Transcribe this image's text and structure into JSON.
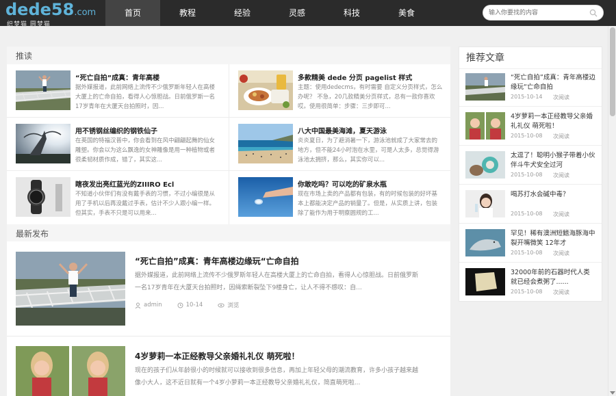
{
  "header": {
    "logo_text": "dede58",
    "logo_domain": ".com",
    "logo_slogan": "织梦猫 圆梦猫",
    "nav": [
      "首页",
      "教程",
      "经验",
      "灵感",
      "科技",
      "美食"
    ],
    "search_placeholder": "输入你要找的内容"
  },
  "recommend": {
    "heading": "推读",
    "items": [
      {
        "title": "“死亡自拍”成真：青年高楼",
        "desc": "据外媒报道，此前网络上流传不少俄罗斯年轻人在高楼大厦上的亡命自拍，看得人心惊胆战。日前俄罗斯一名17岁青年在大厦天台拍照时，因..."
      },
      {
        "title": "多款精美 dede 分页 pagelist 样式",
        "desc": "主题：使用dedecms，有时需要 自定义分页样式，怎么办呢？ 不急，20几款精美分页样式，总有一款你喜欢哎。使用很简单：步骤：三步即可..."
      },
      {
        "title": "用不锈钢丝编织的钢铁仙子",
        "desc": "在英国的特福汉普中，你会看到在风中翩翩起舞的仙女雕塑。你会以为这么飘逸的女神雕像是用一种植物或者很柔韧材质作成，错了，其实这..."
      },
      {
        "title": "八大中国最美海滩，夏天游泳",
        "desc": "炎炎夏日，为了避消暑一下，游泳池就成了大家常去的地方，但不能24小时泡在水里，可是人太多，总觉得游泳池太拥挤，那么，其实你可以..."
      },
      {
        "title": "瞎夜发出亮红蓝光的ZIIIRO Ecl",
        "desc": "不知道小伙伴们有没有戴手表的习惯，不过小编很是从用了手机以后再没戴过手表，估计不少人跟小编一样。但其实，手表不只是可以用来..."
      },
      {
        "title": "你敢吃吗？可以吃的矿泉水瓶",
        "desc": "现在市场上卖的产品都有包装，有的时候包装的好坏基本上都能决定产品的销量了。但是，从实质上讲，包装除了能作为用于明察圆规的工..."
      }
    ]
  },
  "latest": {
    "heading": "最新发布",
    "items": [
      {
        "title": "“死亡自拍”成真：青年高楼边缘玩“亡命自拍",
        "desc": "据外媒报道，此前网络上流传不少俄罗斯年轻人在高楼大厦上的亡命自拍，看得人心惊胆战。日前俄罗斯一名17岁青年在大厦天台拍照时，因绳索断裂坠下9楼身亡，让人不得不感叹：自...",
        "author": "admin",
        "date": "10-14",
        "views": "浏览"
      },
      {
        "title": "4岁萝莉一本正经教导父亲婚礼礼仪 萌死啦！",
        "desc": "现在的孩子们从年龄很小的时候就可以接收到很多信息，再加上年轻父母的潮流教育，许多小孩子越来越像小大人，这不近日就有一个4岁小萝莉一本正经教导父亲婚礼礼仪，简直萌死啦..."
      }
    ]
  },
  "sidebar": {
    "heading": "推荐文章",
    "items": [
      {
        "title": "“死亡自拍”成真：青年高楼边缘玩“亡命自拍",
        "date": "2015-10-14",
        "views": "次阅读"
      },
      {
        "title": "4岁萝莉一本正经教导父亲婚礼礼仪 萌死啦！",
        "date": "2015-10-08",
        "views": "次阅读"
      },
      {
        "title": "太逗了！聪明小猴子带着小伙伴斗牛犬安全过河",
        "date": "2015-10-08",
        "views": "次阅读"
      },
      {
        "title": "喝苏打水会碱中毒？",
        "date": "2015-10-08",
        "views": "次阅读"
      },
      {
        "title": "罕见！稀有澳洲短鳍海豚海中裂开嘴微笑 12年才",
        "date": "2015-10-08",
        "views": "次阅读"
      },
      {
        "title": "32000年前的石器时代人类就已经会煮粥了......",
        "date": "2015-10-08",
        "views": "次阅读"
      }
    ]
  },
  "colors": {
    "header_bg": "#2b2b2b",
    "logo": "#5fb3d9",
    "nav_active": "#444444"
  }
}
